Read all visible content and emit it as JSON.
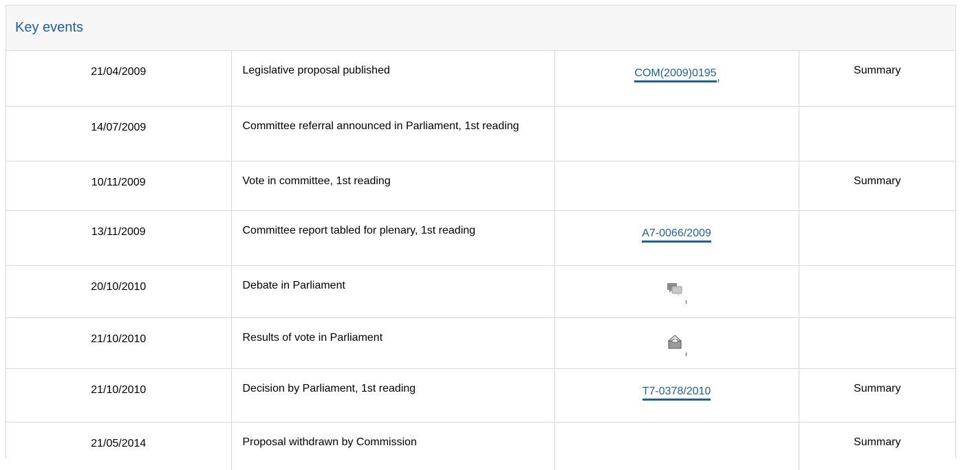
{
  "panel": {
    "title": "Key events"
  },
  "events": [
    {
      "date": "21/04/2009",
      "event": "Legislative proposal published",
      "ref": "COM(2009)0195",
      "ref_type": "link",
      "summary": "Summary"
    },
    {
      "date": "14/07/2009",
      "event": "Committee referral announced in Parliament, 1st reading",
      "ref": "",
      "ref_type": "none",
      "summary": ""
    },
    {
      "date": "10/11/2009",
      "event": "Vote in committee, 1st reading",
      "ref": "",
      "ref_type": "none",
      "summary": "Summary"
    },
    {
      "date": "13/11/2009",
      "event": "Committee report tabled for plenary, 1st reading",
      "ref": "A7-0066/2009",
      "ref_type": "link",
      "summary": ""
    },
    {
      "date": "20/10/2010",
      "event": "Debate in Parliament",
      "ref": "",
      "ref_type": "debate-icon",
      "summary": ""
    },
    {
      "date": "21/10/2010",
      "event": "Results of vote in Parliament",
      "ref": "",
      "ref_type": "vote-icon",
      "summary": ""
    },
    {
      "date": "21/10/2010",
      "event": "Decision by Parliament, 1st reading",
      "ref": "T7-0378/2010",
      "ref_type": "link",
      "summary": "Summary"
    },
    {
      "date": "21/05/2014",
      "event": "Proposal withdrawn by Commission",
      "ref": "",
      "ref_type": "none",
      "summary": "Summary"
    }
  ],
  "colors": {
    "link": "#1f5e96",
    "border": "#d8d8d8",
    "header_bg": "#f6f6f6"
  }
}
